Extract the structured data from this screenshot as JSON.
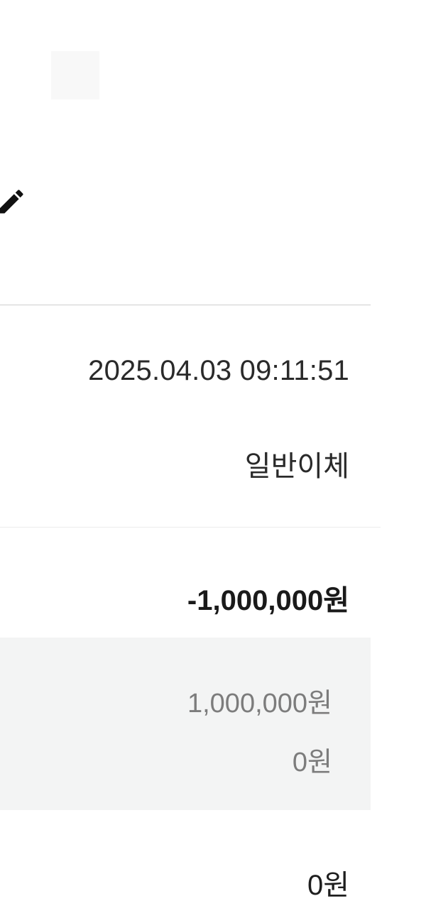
{
  "icons": {
    "edit": "pencil-icon"
  },
  "transaction": {
    "datetime": "2025.04.03 09:11:51",
    "type": "일반이체",
    "amount": "-1,000,000원",
    "details": [
      "1,000,000원",
      "0원"
    ],
    "balance": "0원"
  },
  "colors": {
    "divider": "#cfcfcf",
    "detail_background": "#f3f4f4",
    "detail_text": "#7c7c7c",
    "primary_text": "#222222"
  }
}
